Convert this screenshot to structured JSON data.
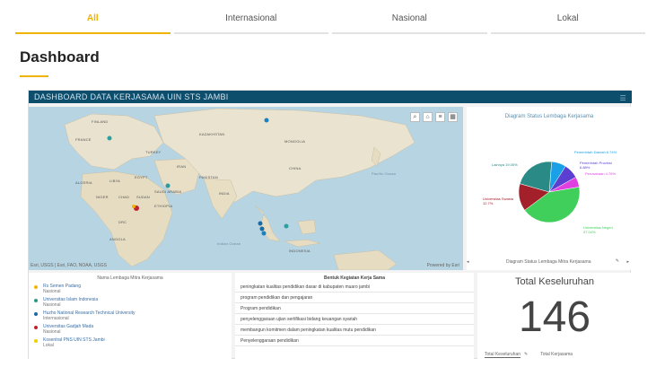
{
  "tabs": [
    "All",
    "Internasional",
    "Nasional",
    "Lokal"
  ],
  "page_title": "Dashboard",
  "dashboard": {
    "header": "DASHBOARD DATA KERJASAMA UIN STS JAMBI",
    "map": {
      "attribution_left": "Esri, USGS | Esri, FAO, NOAA, USGS",
      "attribution_right": "Powered by Esri",
      "labels": [
        "FINLAND",
        "FRANCE",
        "TURKEY",
        "MONGOLIA",
        "CHINA",
        "PAKISTAN",
        "INDIA",
        "ALGERIA",
        "LIBYA",
        "SAUDI ARABIA",
        "NIGER",
        "CHAD",
        "DRC",
        "ANGOLA",
        "INDONESIA",
        "KAZAKHSTAN",
        "IRAN",
        "EGYPT",
        "SUDAN",
        "ETHIOPIA",
        "Pacific Ocean",
        "Indian Ocean"
      ]
    },
    "pie": {
      "title": "Diagram Status Lembaga Kerjasama",
      "footer": "Diagram Status Lembaga Mitra Kerjasama",
      "slices": [
        {
          "label": "Universitas Negeri 37.04%",
          "value": 37.04,
          "color": "#3fcf5a"
        },
        {
          "label": "Universitas Swasta 12.7%",
          "value": 12.7,
          "color": "#a3202a"
        },
        {
          "label": "Lainnya 19.05%",
          "value": 19.05,
          "color": "#2a8a86"
        },
        {
          "label": "Pemerintah Daerah 6.74%",
          "value": 6.74,
          "color": "#1aa0e6"
        },
        {
          "label": "Pemerintah Provinsi 6.88%",
          "value": 6.88,
          "color": "#5b3fd0"
        },
        {
          "label": "Perusahaan 4.76%",
          "value": 4.76,
          "color": "#e040e0"
        }
      ]
    },
    "list": {
      "header": "Nama Lembaga Mitra Kerjasama",
      "items": [
        {
          "name": "Rs Semen Padang",
          "scope": "Nasional",
          "color": "#f0b400"
        },
        {
          "name": "Universitas Islam Indonesia",
          "scope": "Nasional",
          "color": "#2a9a8a"
        },
        {
          "name": "Huzho National Research Technical University",
          "scope": "Internasional",
          "color": "#1a6aa6"
        },
        {
          "name": "Universitas Gadjah Mada",
          "scope": "Nasional",
          "color": "#c02030"
        },
        {
          "name": "Kosentral PNS UIN STS Jambi",
          "scope": "Lokal",
          "color": "#f0d000"
        }
      ]
    },
    "table": {
      "header": "Bentuk Kegiatan Kerja Sama",
      "rows": [
        "peningkatan kualitas pendidikan dasar di kabupaten muaro jambi",
        "program pendidikan dan pengajaran",
        "Program pendidikan",
        "penyelenggaraan ujian sertifikasi bidang keuangan syariah",
        "membangun komitmen dalam peningkatan kualitas mutu pendidikan",
        "Penyelenggaraan pendidikan"
      ]
    },
    "total": {
      "title": "Total Keseluruhan",
      "value": "146",
      "tabs": [
        "Total Keseluruhan",
        "Total Kerjasama"
      ]
    }
  }
}
